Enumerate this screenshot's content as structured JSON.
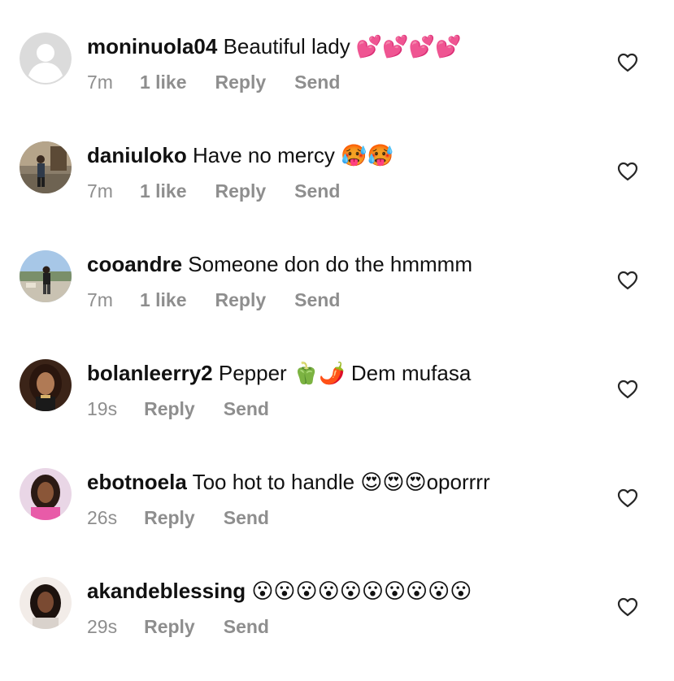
{
  "comments": [
    {
      "username": "moninuola04",
      "text": "Beautiful lady 💕💕💕💕",
      "time": "7m",
      "likes": "1 like",
      "reply": "Reply",
      "send": "Send",
      "avatar_icon": "default-avatar-icon"
    },
    {
      "username": "daniuloko",
      "text": "Have no mercy 🥵🥵",
      "time": "7m",
      "likes": "1 like",
      "reply": "Reply",
      "send": "Send",
      "avatar_icon": "user-avatar"
    },
    {
      "username": "cooandre",
      "text": "Someone don do the hmmmm",
      "time": "7m",
      "likes": "1 like",
      "reply": "Reply",
      "send": "Send",
      "avatar_icon": "user-avatar"
    },
    {
      "username": "bolanleerry2",
      "text": "Pepper 🫑🌶️ Dem mufasa",
      "time": "19s",
      "likes": "",
      "reply": "Reply",
      "send": "Send",
      "avatar_icon": "user-avatar"
    },
    {
      "username": "ebotnoela",
      "text": "Too hot to handle 😍😍😍oporrrr",
      "time": "26s",
      "likes": "",
      "reply": "Reply",
      "send": "Send",
      "avatar_icon": "user-avatar"
    },
    {
      "username": "akandeblessing",
      "text": "😮😮😮😮😮😮😮😮😮😮",
      "time": "29s",
      "likes": "",
      "reply": "Reply",
      "send": "Send",
      "avatar_icon": "user-avatar"
    }
  ],
  "colors": {
    "meta_gray": "#8e8e8e",
    "text": "#111111",
    "background": "#ffffff"
  },
  "icons": {
    "like": "heart-outline-icon"
  }
}
